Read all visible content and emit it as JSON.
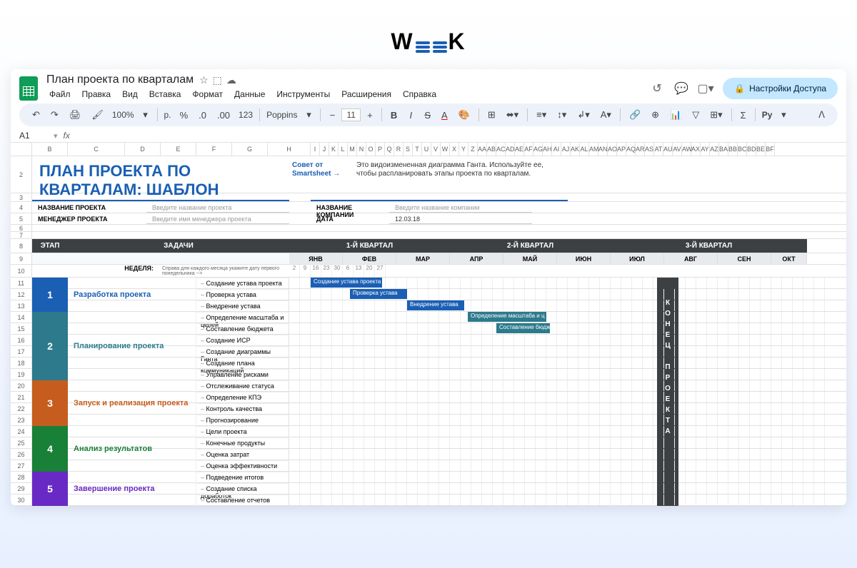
{
  "brand_logo": "WEEEK",
  "doc_title": "План проекта по кварталам",
  "menu": [
    "Файл",
    "Правка",
    "Вид",
    "Вставка",
    "Формат",
    "Данные",
    "Инструменты",
    "Расширения",
    "Справка"
  ],
  "share_btn": "Настройки Доступа",
  "toolbar": {
    "zoom": "100%",
    "currency": "р.",
    "decimals": "123",
    "font": "Poppins",
    "size": "11",
    "py": "Py"
  },
  "cell_ref": "A1",
  "title": "ПЛАН ПРОЕКТА ПО КВАРТАЛАМ: ШАБЛОН",
  "tip_label": "Совет от Smartsheet →",
  "tip_text": "Это видоизмененная диаграмма Ганта. Используйте ее, чтобы распланировать этапы проекта по кварталам.",
  "meta": {
    "proj_name_lbl": "НАЗВАНИЕ ПРОЕКТА",
    "proj_name_val": "Введите название проекта",
    "manager_lbl": "МЕНЕДЖЕР ПРОЕКТА",
    "manager_val": "Введите имя менеджера проекта",
    "company_lbl": "НАЗВАНИЕ КОМПАНИИ",
    "company_val": "Введите название компании",
    "date_lbl": "ДАТА",
    "date_val": "12.03.18"
  },
  "headers": {
    "stage": "ЭТАП",
    "tasks": "ЗАДАЧИ",
    "q1": "1-Й КВАРТАЛ",
    "q2": "2-Й КВАРТАЛ",
    "q3": "3-Й КВАРТАЛ",
    "week": "НЕДЕЛЯ:",
    "week_note": "Справа для каждого месяца укажите дату первого понедельника -->",
    "end": "КОНЕЦ ПРОЕКТА"
  },
  "months": [
    "ЯНВ",
    "ФЕВ",
    "МАР",
    "АПР",
    "МАЙ",
    "ИЮН",
    "ИЮЛ",
    "АВГ",
    "СЕН",
    "ОКТ"
  ],
  "days": [
    "2",
    "9",
    "16",
    "23",
    "30",
    "6",
    "13",
    "20",
    "27"
  ],
  "stages": [
    {
      "num": "1",
      "title": "Разработка проекта",
      "color": "#1a5fb4",
      "text_color": "#1a5fb4",
      "tasks": [
        "Создание устава проекта",
        "Проверка устава",
        "Внедрение устава"
      ]
    },
    {
      "num": "2",
      "title": "Планирование проекта",
      "color": "#2d7a8c",
      "text_color": "#2d7a8c",
      "tasks": [
        "Определение масштаба и целей",
        "Составление бюджета",
        "Создание ИСР",
        "Создание диаграммы Ганта",
        "Создание плана коммуникаций",
        "Управление рисками"
      ]
    },
    {
      "num": "3",
      "title": "Запуск и реализация проекта",
      "color": "#c65d1e",
      "text_color": "#c65d1e",
      "tasks": [
        "Отслеживание статуса",
        "Определение КПЭ",
        "Контроль качества",
        "Прогнозирование"
      ]
    },
    {
      "num": "4",
      "title": "Анализ результатов",
      "color": "#198038",
      "text_color": "#198038",
      "tasks": [
        "Цели проекта",
        "Конечные продукты",
        "Оценка затрат",
        "Оценка эффективности"
      ]
    },
    {
      "num": "5",
      "title": "Завершение проекта",
      "color": "#6929c4",
      "text_color": "#6929c4",
      "tasks": [
        "Подведение итогов",
        "Создание списка доработок",
        "Составление отчетов"
      ]
    }
  ],
  "gantt_bars": [
    {
      "row": 11,
      "label": "Создание устава проекта",
      "color": "#1a5fb4"
    },
    {
      "row": 12,
      "label": "Проверка устава",
      "color": "#1a5fb4"
    },
    {
      "row": 13,
      "label": "Внедрение устава",
      "color": "#1a5fb4"
    },
    {
      "row": 14,
      "label": "Определение масштаба и ц",
      "color": "#2d7a8c"
    },
    {
      "row": 15,
      "label": "Составление бюдж",
      "color": "#2d7a8c"
    }
  ],
  "col_letters": [
    "B",
    "C",
    "D",
    "E",
    "F",
    "G",
    "H",
    "I",
    "J",
    "K",
    "L",
    "M",
    "N",
    "O",
    "P",
    "Q",
    "R",
    "S",
    "T",
    "U",
    "V",
    "W",
    "X",
    "Y",
    "Z",
    "AA",
    "AB",
    "AC",
    "AD",
    "AE",
    "AF",
    "AG",
    "AH",
    "AI",
    "AJ",
    "AK",
    "AL",
    "AM",
    "AN",
    "AO",
    "AP",
    "AQ",
    "AR",
    "AS",
    "AT",
    "AU",
    "AV",
    "AW",
    "AX",
    "AY",
    "AZ",
    "BA",
    "BB",
    "BC",
    "BD",
    "BE",
    "BF"
  ]
}
